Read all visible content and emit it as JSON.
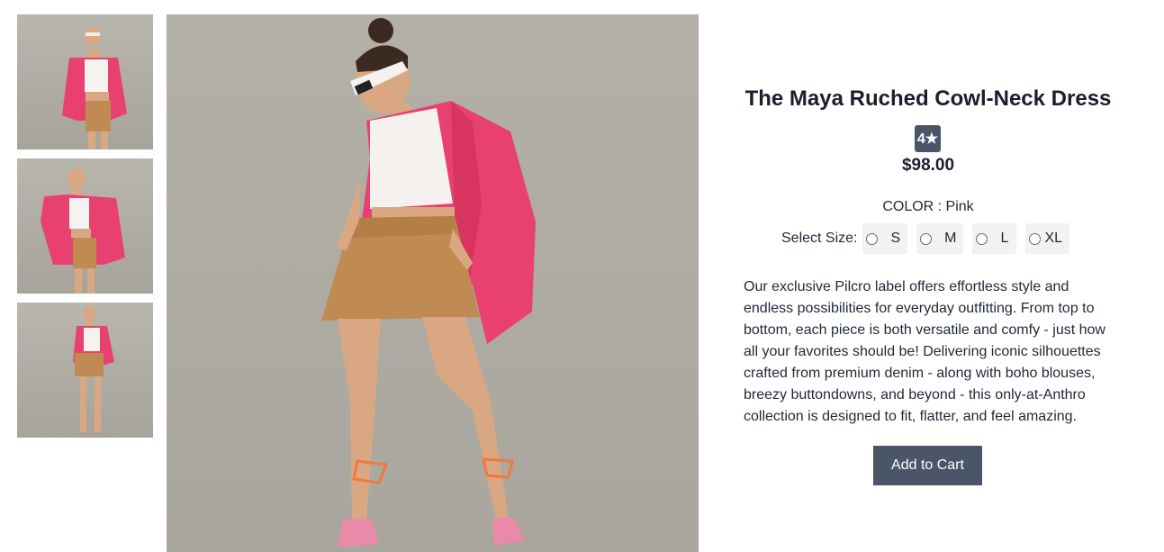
{
  "product": {
    "title": "The Maya Ruched Cowl-Neck Dress",
    "rating_badge": "4★",
    "price": "$98.00",
    "color_label": "COLOR : Pink",
    "size_label": "Select Size:",
    "sizes": [
      "S",
      "M",
      "L",
      "XL"
    ],
    "description": "Our exclusive Pilcro label offers effortless style and endless possibilities for everyday outfitting. From top to bottom, each piece is both versatile and comfy - just how all your favorites should be! Delivering iconic silhouettes crafted from premium denim - along with boho blouses, breezy buttondowns, and beyond - this only-at-Anthro collection is designed to fit, flatter, and feel amazing.",
    "add_to_cart": "Add to Cart"
  },
  "gallery": {
    "thumbnails": [
      "thumbnail-front",
      "thumbnail-arm-raised",
      "thumbnail-full-length"
    ],
    "main_image": "model-pink-shirt-tan-skirt"
  },
  "colors": {
    "accent": "#4a5568",
    "shirt": "#e8416f",
    "skirt": "#c08b52",
    "background": "#aeaba3"
  }
}
